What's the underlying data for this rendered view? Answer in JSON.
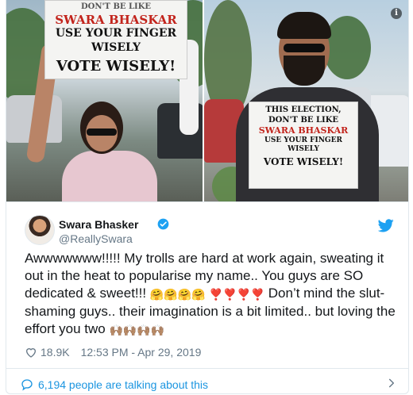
{
  "media": {
    "left_sign": [
      "DON'T BE LIKE",
      "SWARA BHASKAR",
      "USE YOUR FINGER WISELY",
      "VOTE WISELY!"
    ],
    "right_sign": [
      "THIS ELECTION,",
      "DON'T BE LIKE",
      "SWARA BHASKAR",
      "USE YOUR FINGER WISELY",
      "VOTE WISELY!"
    ],
    "info_glyph": "i"
  },
  "tweet": {
    "author_name": "Swara Bhasker",
    "handle": "@ReallySwara",
    "text_part1": "Awwwwwww!!!!! My trolls are hard at work again, sweating it out in the heat to popularise my name.. You guys are SO dedicated & sweet!!! ",
    "hug_emojis": "🤗🤗🤗🤗",
    "heart_emojis": "❣️❣️❣️❣️",
    "text_part2": " Don’t mind the slut-shaming guys.. their imagination is a bit limited.. but loving the effort you two ",
    "hand_emojis": "🙌🏽🙌🏽🙌🏽🙌🏽",
    "like_count": "18.9K",
    "timestamp": "12:53 PM - Apr 29, 2019",
    "talking_text": "6,194 people are talking about this"
  },
  "icons": {
    "verified": "verified-badge-icon",
    "brand": "twitter-bird-icon",
    "like": "heart-icon",
    "talk": "speech-bubble-icon",
    "more": "chevron-right-icon"
  },
  "colors": {
    "brand_blue": "#1da1f2",
    "link_blue": "#1b95e0",
    "muted": "#657786"
  }
}
